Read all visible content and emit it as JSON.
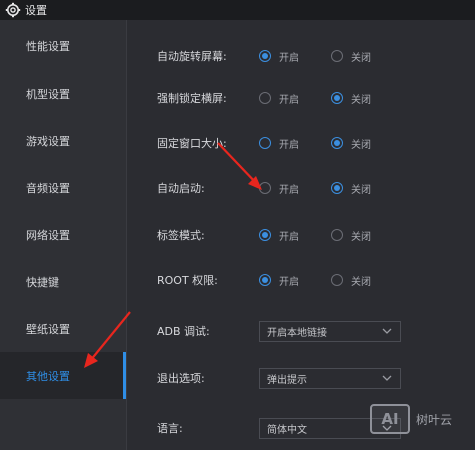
{
  "window": {
    "title": "设置"
  },
  "sidebar": {
    "items": [
      {
        "label": "性能设置",
        "active": false
      },
      {
        "label": "机型设置",
        "active": false
      },
      {
        "label": "游戏设置",
        "active": false
      },
      {
        "label": "音频设置",
        "active": false
      },
      {
        "label": "网络设置",
        "active": false
      },
      {
        "label": "快捷键",
        "active": false
      },
      {
        "label": "壁纸设置",
        "active": false
      },
      {
        "label": "其他设置",
        "active": true
      }
    ]
  },
  "settings": {
    "rows": [
      {
        "label": "自动旋转屏幕:",
        "on_label": "开启",
        "off_label": "关闭",
        "selected": "on"
      },
      {
        "label": "强制锁定横屏:",
        "on_label": "开启",
        "off_label": "关闭",
        "selected": "off"
      },
      {
        "label": "固定窗口大小:",
        "on_label": "开启",
        "off_label": "关闭",
        "selected": "off"
      },
      {
        "label": "自动启动:",
        "on_label": "开启",
        "off_label": "关闭",
        "selected": "off"
      },
      {
        "label": "标签模式:",
        "on_label": "开启",
        "off_label": "关闭",
        "selected": "on"
      },
      {
        "label": "ROOT 权限:",
        "on_label": "开启",
        "off_label": "关闭",
        "selected": "on"
      }
    ],
    "adb": {
      "label": "ADB 调试:",
      "value": "开启本地链接"
    },
    "exit": {
      "label": "退出选项:",
      "value": "弹出提示"
    },
    "language": {
      "label": "语言:",
      "value": "简体中文"
    }
  },
  "watermark": {
    "logo": "AI",
    "text": "树叶云"
  },
  "colors": {
    "accent": "#2f8ee6",
    "arrow": "#e8261e",
    "sidebar_bg": "#2f3035",
    "content_bg": "#2b2c31"
  }
}
